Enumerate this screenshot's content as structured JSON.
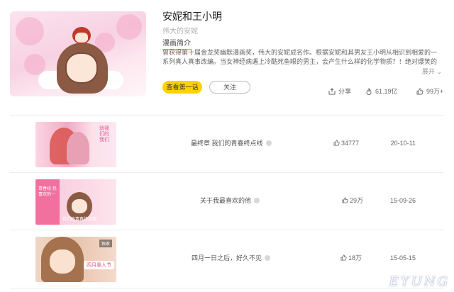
{
  "comic": {
    "title": "安妮和王小明",
    "author": "伟大的安妮",
    "section_label": "漫画简介",
    "description": "曾获得第十届金龙奖幽默漫画奖，伟大的安妮成名作。根据安妮和其男友王小明从相识到相爱的一系列真人真事改编。当女神经病遇上冷酷死鱼眼的男主，会产生什么样的化学物质？！绝对爆笑的治愈系漫画，最无节操的恋爱指",
    "expand_label": "展开",
    "read_button": "查看第一话",
    "follow_button": "关注",
    "share_label": "分享",
    "views": "61.19亿",
    "likes": "99万+"
  },
  "episodes": [
    {
      "title": "最终章 我们的青春终点线",
      "likes": "34777",
      "date": "20-10-11"
    },
    {
      "title": "关于我最喜欢的他",
      "likes": "29万",
      "date": "15-09-26"
    },
    {
      "title": "四月一日之后，好久不见",
      "likes": "18万",
      "date": "15-05-15"
    }
  ],
  "thumbs": {
    "t1_vertical_text": "就我们的我们",
    "t2_side_text": "青春线\n我喜欢的一",
    "t2_bottom_text": "我们的青春终点线",
    "t3_badge": "独家",
    "t3_bubble": "四月愚人节"
  },
  "watermark": "EYUNG",
  "colors": {
    "accent": "#ffd100",
    "underline": "#f5c518"
  },
  "icons": [
    "share-icon",
    "views-icon",
    "thumbs-up-icon",
    "lock-icon"
  ]
}
